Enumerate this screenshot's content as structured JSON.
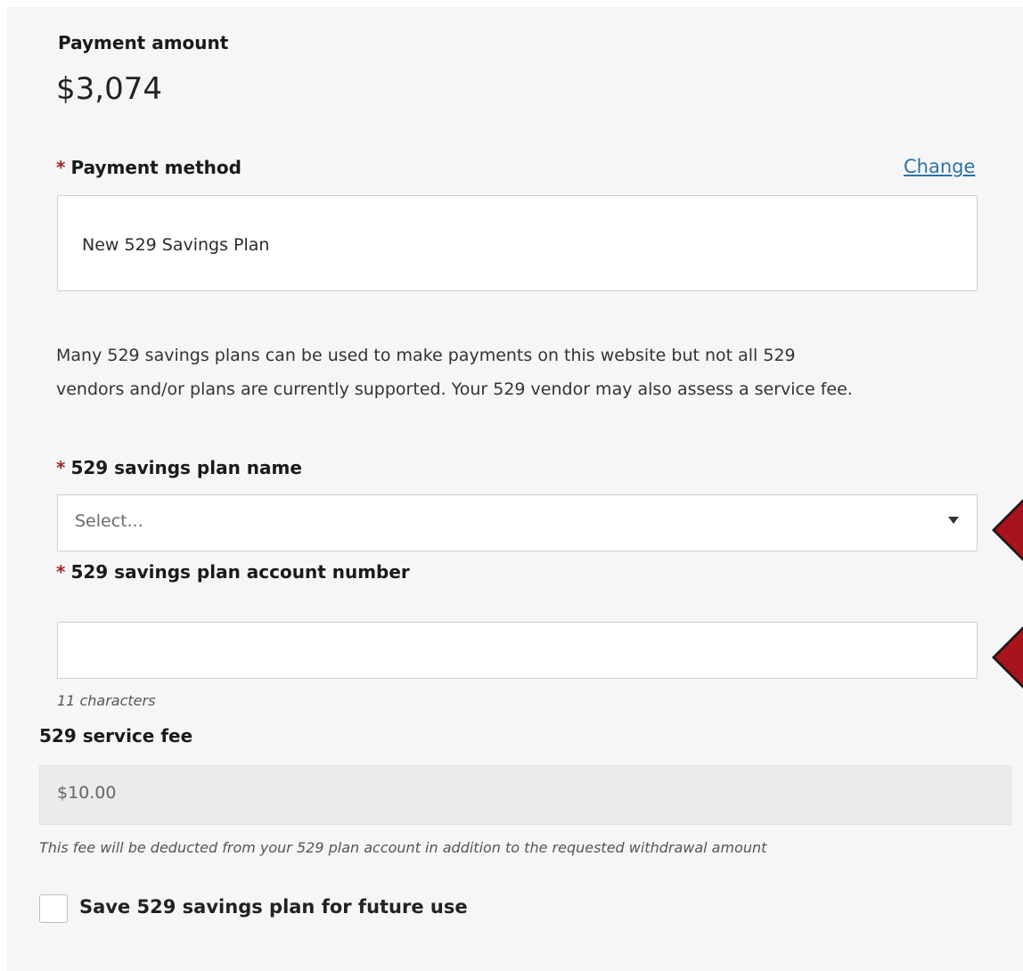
{
  "payment_amount": {
    "label": "Payment amount",
    "value": "$3,074"
  },
  "payment_method": {
    "required_marker": "*",
    "label": "Payment method",
    "change_link": "Change",
    "value": "New 529 Savings Plan"
  },
  "description": {
    "line1": "Many 529 savings plans can be used to make payments on this website but not all 529",
    "line2": "vendors and/or plans are currently supported. Your 529 vendor may also assess a service fee."
  },
  "plan_name": {
    "required_marker": "*",
    "label": "529 savings plan name",
    "selected_value": "Select..."
  },
  "account_number": {
    "required_marker": "*",
    "label": "529 savings plan account number",
    "value": "",
    "hint": "11 characters"
  },
  "service_fee": {
    "label": "529 service fee",
    "value": "$10.00",
    "note": "This fee will be deducted from your 529 plan account in addition to the requested withdrawal amount"
  },
  "save_option": {
    "label": "Save 529 savings plan for future use",
    "checked": false
  },
  "colors": {
    "panel_background": "#f6f6f6",
    "required": "#a0262b",
    "link": "#2a73a8",
    "arrow": "#a8141c"
  }
}
